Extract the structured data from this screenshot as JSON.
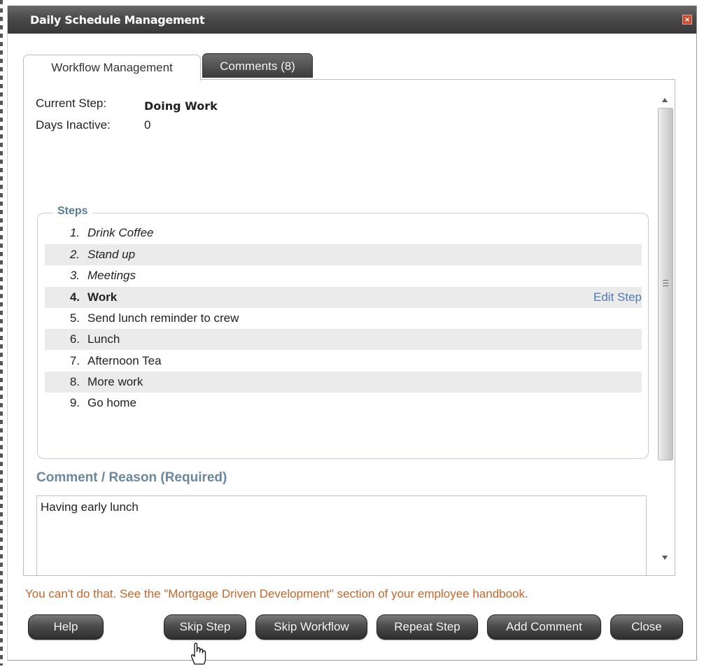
{
  "dialog": {
    "title": "Daily Schedule Management",
    "close_glyph": "×"
  },
  "tabs": [
    {
      "label": "Workflow Management",
      "active": true
    },
    {
      "label": "Comments (8)",
      "active": false
    }
  ],
  "workflow": {
    "current_step_label": "Current Step:",
    "current_step_value": "Doing Work",
    "days_inactive_label": "Days Inactive:",
    "days_inactive_value": "0"
  },
  "steps": {
    "legend": "Steps",
    "edit_label": "Edit Step",
    "items": [
      {
        "num": "1.",
        "label": "Drink Coffee"
      },
      {
        "num": "2.",
        "label": "Stand up"
      },
      {
        "num": "3.",
        "label": "Meetings"
      },
      {
        "num": "4.",
        "label": "Work"
      },
      {
        "num": "5.",
        "label": "Send lunch reminder to crew"
      },
      {
        "num": "6.",
        "label": "Lunch"
      },
      {
        "num": "7.",
        "label": "Afternoon Tea"
      },
      {
        "num": "8.",
        "label": "More work"
      },
      {
        "num": "9.",
        "label": "Go home"
      }
    ]
  },
  "comment": {
    "heading": "Comment / Reason (Required)",
    "value": "Having early lunch"
  },
  "error_message": "You can't do that. See the \"Mortgage Driven Development\" section of your employee handbook.",
  "buttons": {
    "help": "Help",
    "skip_step": "Skip Step",
    "skip_workflow": "Skip Workflow",
    "repeat_step": "Repeat Step",
    "add_comment": "Add Comment",
    "close": "Close"
  },
  "colors": {
    "titlebar": "#4a4a4a",
    "steps_legend": "#5b7a99",
    "edit_link": "#4f7bb0",
    "error_text": "#c3672b",
    "row_shade": "#ebebeb"
  },
  "icons": {
    "close": "close-icon",
    "scroll_up": "scroll-up-arrow-icon",
    "scroll_down": "scroll-down-arrow-icon",
    "cursor": "hand-pointer-cursor-icon"
  }
}
